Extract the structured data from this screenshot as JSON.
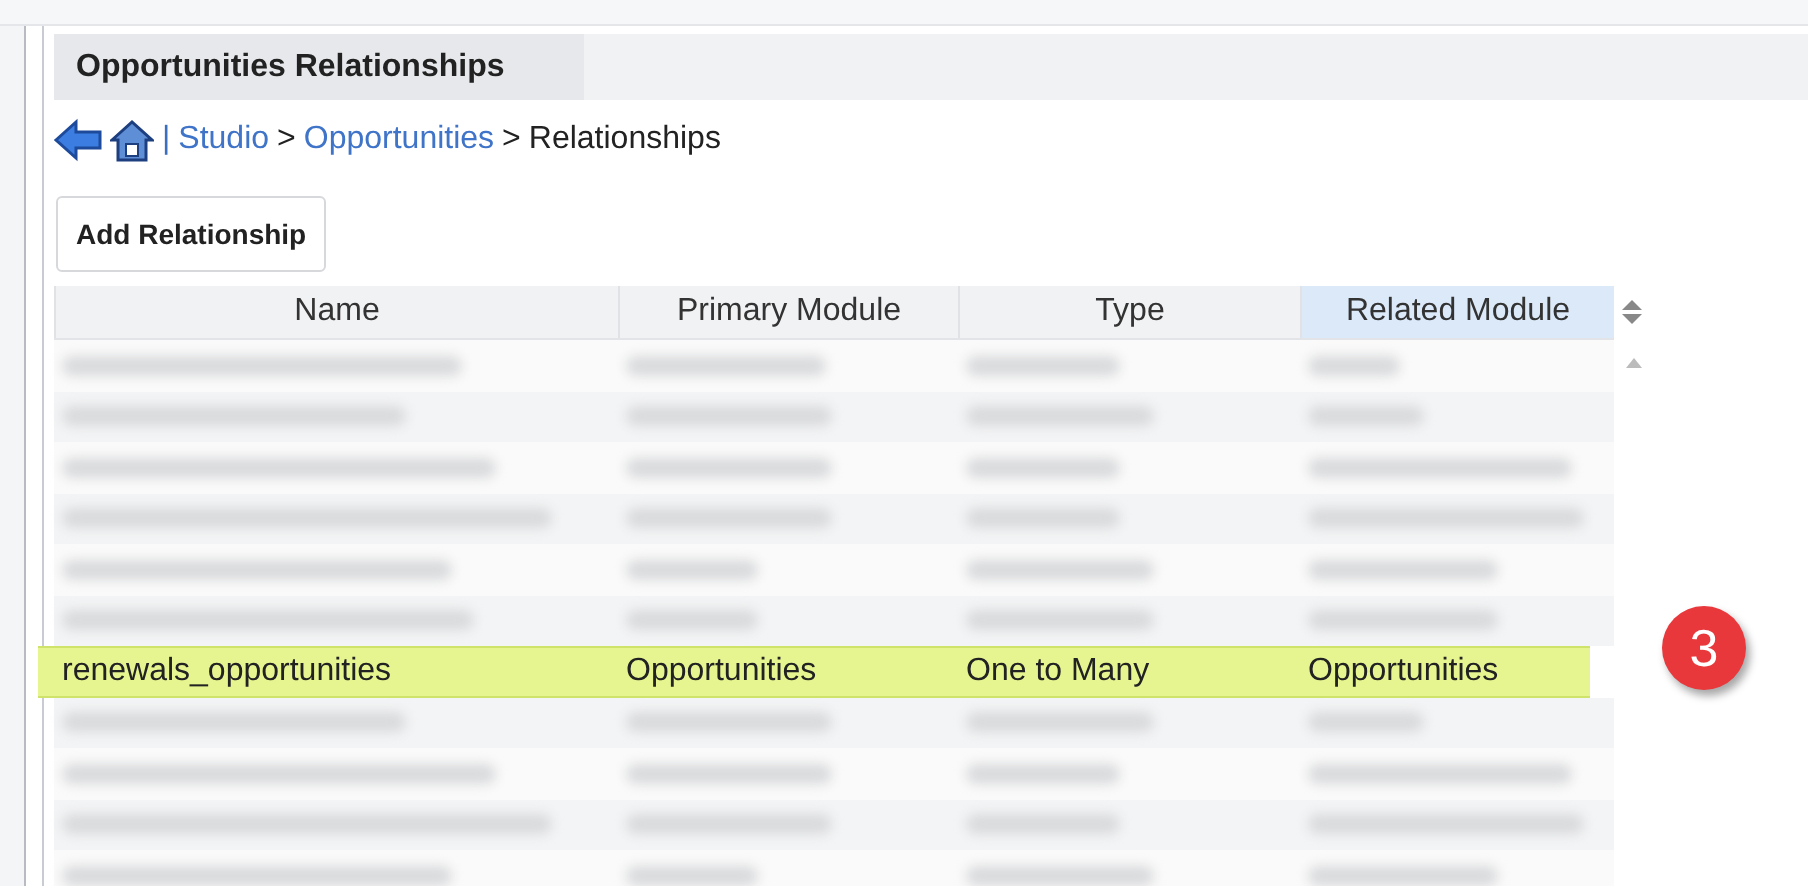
{
  "panel": {
    "title": "Opportunities Relationships"
  },
  "breadcrumb": {
    "separator": "|",
    "links": [
      "Studio",
      "Opportunities"
    ],
    "arrow": ">",
    "current": "Relationships"
  },
  "buttons": [
    "Add Relationship"
  ],
  "table": {
    "columns": [
      {
        "label": "Name",
        "sorted": false
      },
      {
        "label": "Primary Module",
        "sorted": false
      },
      {
        "label": "Type",
        "sorted": false
      },
      {
        "label": "Related Module",
        "sorted": true
      }
    ],
    "rows": [
      {
        "kind": "blurred",
        "highlighted": false
      },
      {
        "kind": "blurred",
        "highlighted": false
      },
      {
        "kind": "blurred",
        "highlighted": false
      },
      {
        "kind": "blurred",
        "highlighted": false
      },
      {
        "kind": "blurred",
        "highlighted": false
      },
      {
        "kind": "blurred",
        "highlighted": false
      },
      {
        "kind": "entry",
        "highlighted": true,
        "cells": [
          "renewals_opportunities",
          "Opportunities",
          "One to Many",
          "Opportunities"
        ]
      },
      {
        "kind": "blurred",
        "highlighted": false
      },
      {
        "kind": "blurred",
        "highlighted": false
      },
      {
        "kind": "blurred",
        "highlighted": false
      },
      {
        "kind": "blurred",
        "highlighted": false
      }
    ]
  },
  "callout": {
    "label": "3"
  }
}
